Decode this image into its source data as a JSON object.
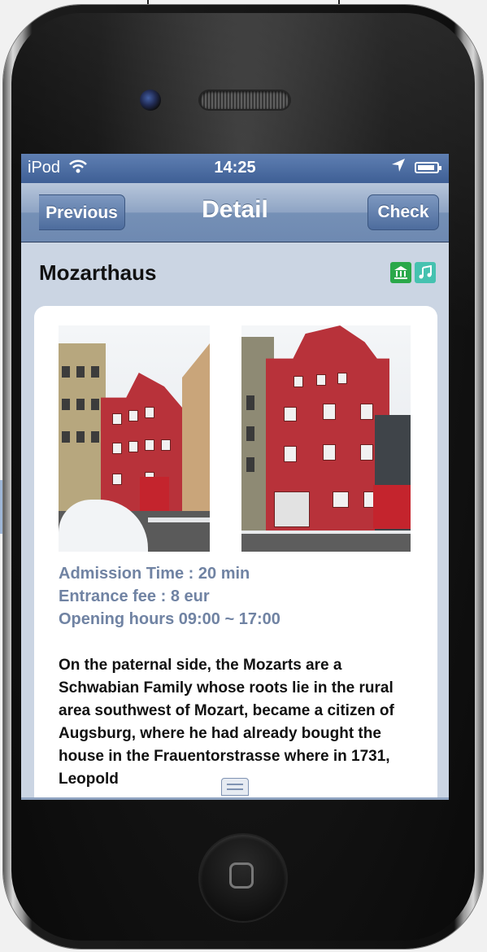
{
  "status_bar": {
    "carrier": "iPod",
    "time": "14:25",
    "wifi_icon": "wifi-icon",
    "location_icon": "location-arrow-icon",
    "battery_icon": "battery-charging-icon"
  },
  "nav": {
    "back_label": "Previous",
    "title": "Detail",
    "action_label": "Check"
  },
  "place": {
    "name": "Mozarthaus",
    "tags": [
      {
        "icon": "museum-icon",
        "glyph": "🏛",
        "color": "#2aa84a"
      },
      {
        "icon": "music-note-icon",
        "glyph": "♫",
        "color": "#45c2b0"
      }
    ],
    "admission_time": "Admission Time : 20 min",
    "entrance_fee": "Entrance fee : 8 eur",
    "opening_hours": "Opening hours 09:00 ~ 17:00",
    "description": "On the paternal side, the Mozarts are a Schwabian Family whose roots lie in the rural area southwest of Mozart, became a citizen of Augsburg, where he had already bought the house in the Frauentorstrasse where in 1731, Leopold"
  },
  "colors": {
    "nav_bar": "#7590b6",
    "content_bg": "#cbd5e3",
    "info_text": "#7083a3",
    "building_red": "#b8323a"
  }
}
